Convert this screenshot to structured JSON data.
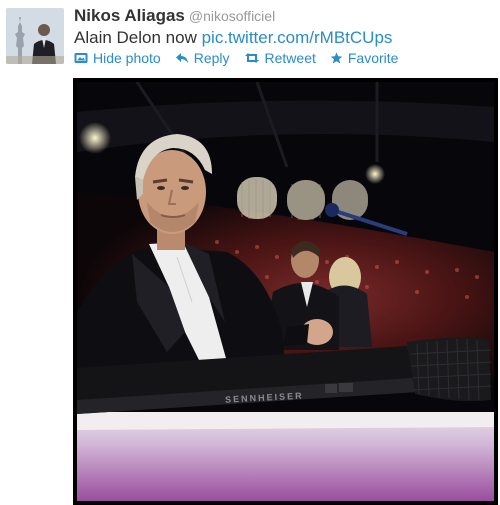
{
  "tweet": {
    "author_name": "Nikos Aliagas",
    "author_handle": "@nikosofficiel",
    "text": "Alain Delon now",
    "link": "pic.twitter.com/rMBtCUps"
  },
  "actions": [
    {
      "label": "Hide photo",
      "icon": "photo-icon"
    },
    {
      "label": "Reply",
      "icon": "reply-icon"
    },
    {
      "label": "Retweet",
      "icon": "retweet-icon"
    },
    {
      "label": "Favorite",
      "icon": "star-icon"
    }
  ],
  "photo": {
    "microphone_brand": "SENNHEISER"
  },
  "colors": {
    "link": "#2a8cc9",
    "name": "#333333",
    "handle": "#999999"
  }
}
